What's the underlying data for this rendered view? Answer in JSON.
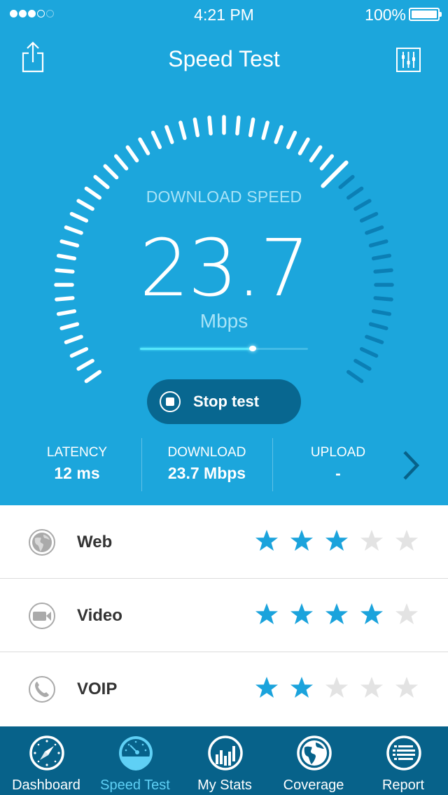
{
  "status_bar": {
    "signal_dots": {
      "filled": 3,
      "total": 5
    },
    "time": "4:21 PM",
    "battery_percent": "100%",
    "battery_level": 1.0
  },
  "header": {
    "title": "Speed Test",
    "left_icon": "share-icon",
    "right_icon": "settings-sliders-icon"
  },
  "gauge": {
    "label": "DOWNLOAD SPEED",
    "value_int": "23",
    "value_sep": ".",
    "value_dec": "7",
    "unit": "Mbps",
    "tick_count": 51,
    "marker_fraction": 0.68,
    "progress_fraction": 0.67,
    "colors": {
      "active_tick": "#ffffff",
      "inactive_tick": "#0b7fb5",
      "progress": "#55e6fb"
    }
  },
  "stop_button": {
    "label": "Stop test",
    "icon": "stop-icon"
  },
  "stats": [
    {
      "label": "LATENCY",
      "value": "12 ms"
    },
    {
      "label": "DOWNLOAD",
      "value": "23.7 Mbps"
    },
    {
      "label": "UPLOAD",
      "value": "-"
    }
  ],
  "stats_next_icon": "chevron-right-icon",
  "ratings": [
    {
      "icon": "globe-icon",
      "label": "Web",
      "stars": 3,
      "max": 5
    },
    {
      "icon": "video-camera-icon",
      "label": "Video",
      "stars": 4,
      "max": 5
    },
    {
      "icon": "phone-icon",
      "label": "VOIP",
      "stars": 2,
      "max": 5
    }
  ],
  "rating_colors": {
    "on": "#1ba3dc",
    "off": "#e3e3e3"
  },
  "tabs": [
    {
      "label": "Dashboard",
      "icon": "compass-icon",
      "active": false
    },
    {
      "label": "Speed Test",
      "icon": "speedometer-icon",
      "active": true
    },
    {
      "label": "My Stats",
      "icon": "bar-chart-icon",
      "active": false
    },
    {
      "label": "Coverage",
      "icon": "globe-icon",
      "active": false
    },
    {
      "label": "Report",
      "icon": "list-icon",
      "active": false
    }
  ]
}
